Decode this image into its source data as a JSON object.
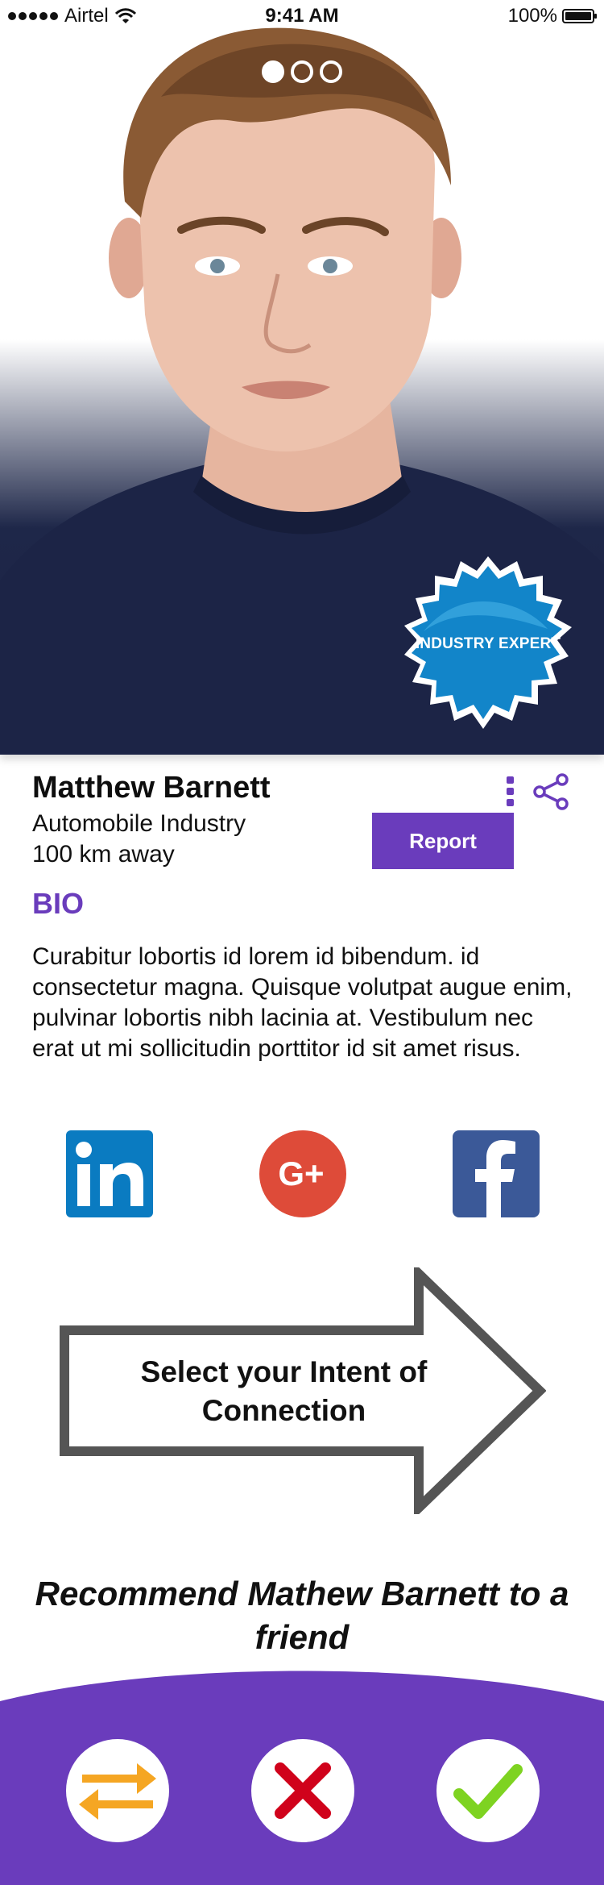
{
  "status_bar": {
    "carrier": "Airtel",
    "time": "9:41 AM",
    "battery": "100%"
  },
  "carousel": {
    "total": 3,
    "active_index": 0
  },
  "badge": {
    "label": "INDUSTRY EXPERT"
  },
  "profile": {
    "name": "Matthew Barnett",
    "industry": "Automobile Industry",
    "distance": "100 km away",
    "report_label": "Report",
    "bio_title": "BIO",
    "bio_text": "Curabitur lobortis id lorem id bibendum. id consectetur magna. Quisque volutpat augue enim, pulvinar lobortis nibh lacinia at. Vestibulum nec erat ut mi sollicitudin porttitor id sit amet risus."
  },
  "social": {
    "linkedin_text": "in",
    "gplus_text": "G+",
    "facebook_text": "f"
  },
  "intent": {
    "label": "Select your Intent of Connection"
  },
  "recommend": {
    "label": "Recommend Mathew Barnett to a friend"
  },
  "colors": {
    "accent": "#6a3cbc",
    "badge": "#1285c9",
    "swap": "#f5a623",
    "reject": "#d0021b",
    "accept": "#7ed321"
  },
  "icons": [
    "wifi-icon",
    "more-icon",
    "share-icon",
    "linkedin-icon",
    "google-plus-icon",
    "facebook-icon",
    "swap-icon",
    "close-icon",
    "check-icon"
  ]
}
